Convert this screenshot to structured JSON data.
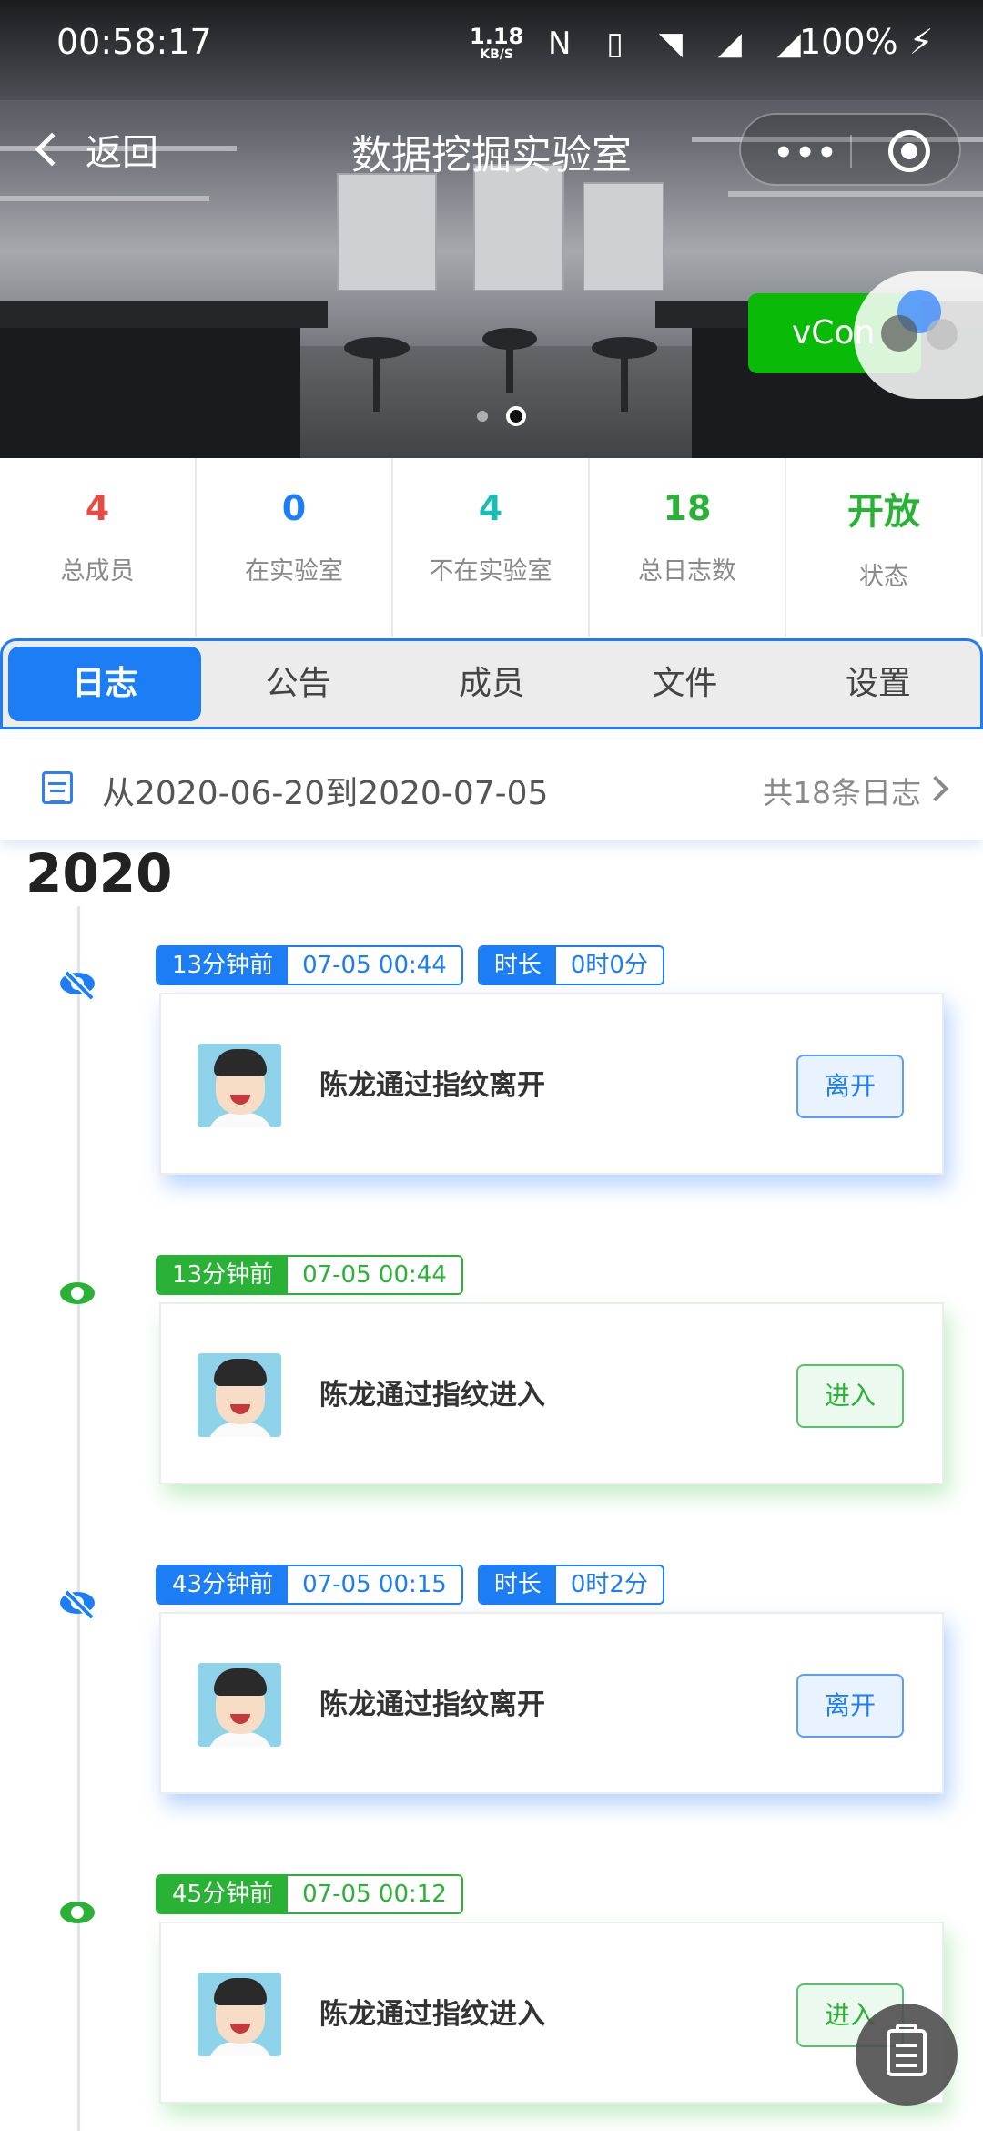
{
  "status_bar": {
    "time": "00:58:17",
    "speed_value": "1.18",
    "speed_unit": "KB/S",
    "icons": "N ▯ ◥ ◢ ◢",
    "battery": "100% ⚡"
  },
  "nav": {
    "back_label": "返回",
    "title": "数据挖掘实验室",
    "more_icon": "•••"
  },
  "vconsole_label": "vCon",
  "stats": [
    {
      "value": "4",
      "label": "总成员",
      "color": "#e54d42"
    },
    {
      "value": "0",
      "label": "在实验室",
      "color": "#1c7df5"
    },
    {
      "value": "4",
      "label": "不在实验室",
      "color": "#1cbbb4"
    },
    {
      "value": "18",
      "label": "总日志数",
      "color": "#29b236"
    },
    {
      "value": "开放",
      "label": "状态",
      "color": "#29b236"
    }
  ],
  "tabs": [
    "日志",
    "公告",
    "成员",
    "文件",
    "设置"
  ],
  "active_tab": "日志",
  "date_range": {
    "text": "从2020-06-20到2020-07-05",
    "count": "共18条日志"
  },
  "year": "2020",
  "entries": [
    {
      "ago": "13分钟前",
      "datetime": "07-05 00:44",
      "duration_label": "时长",
      "duration": "0时0分",
      "message": "陈龙通过指纹离开",
      "action": "离开",
      "type": "leave"
    },
    {
      "ago": "13分钟前",
      "datetime": "07-05 00:44",
      "message": "陈龙通过指纹进入",
      "action": "进入",
      "type": "enter"
    },
    {
      "ago": "43分钟前",
      "datetime": "07-05 00:15",
      "duration_label": "时长",
      "duration": "0时2分",
      "message": "陈龙通过指纹离开",
      "action": "离开",
      "type": "leave"
    },
    {
      "ago": "45分钟前",
      "datetime": "07-05 00:12",
      "message": "陈龙通过指纹进入",
      "action": "进入",
      "type": "enter"
    }
  ],
  "colors": {
    "primary_blue": "#1c7df5",
    "green": "#29b236",
    "red": "#e54d42",
    "vconsole_green": "#09bb07"
  }
}
